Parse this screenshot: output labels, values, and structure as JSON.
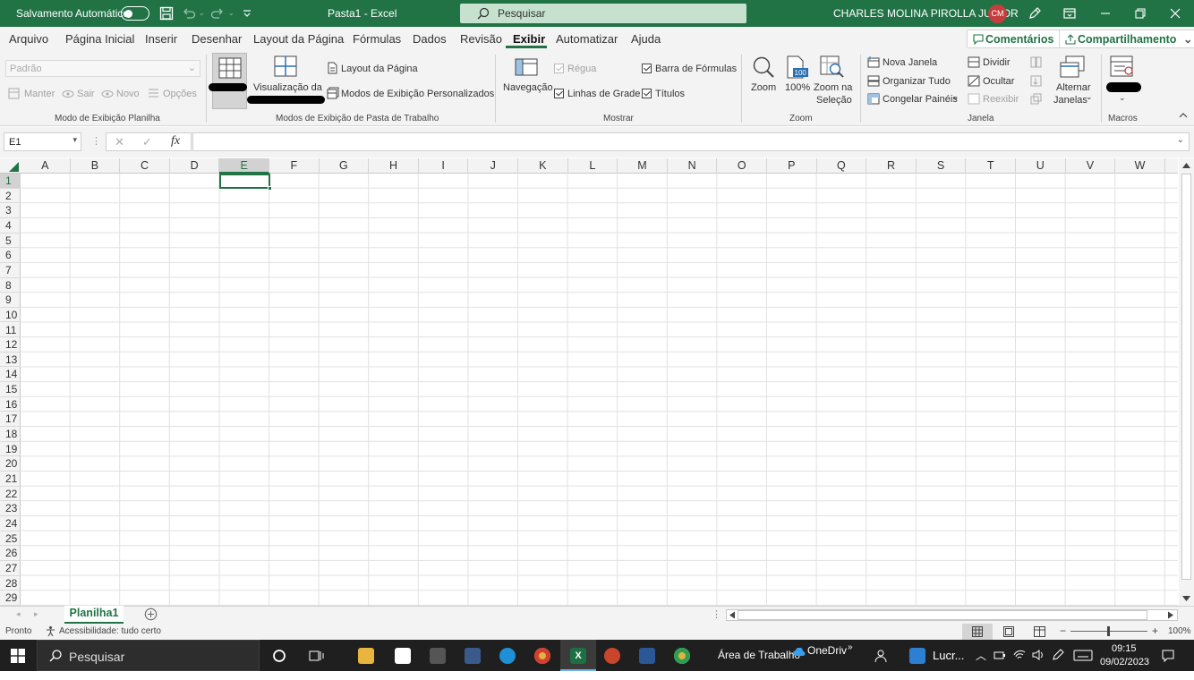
{
  "titlebar": {
    "autosave_label": "Salvamento Automático",
    "doc_title": "Pasta1  -  Excel",
    "search_placeholder": "Pesquisar",
    "user_name": "CHARLES MOLINA PIROLLA JUNIOR",
    "user_initials": "CM"
  },
  "tabs": [
    "Arquivo",
    "Página Inicial",
    "Inserir",
    "Desenhar",
    "Layout da Página",
    "Fórmulas",
    "Dados",
    "Revisão",
    "Exibir",
    "Automatizar",
    "Ajuda"
  ],
  "active_tab": "Exibir",
  "comments_label": "Comentários",
  "share_label": "Compartilhamento",
  "ribbon": {
    "sheet_view": {
      "dropdown_value": "Padrão",
      "keep": "Manter",
      "exit": "Sair",
      "new": "Novo",
      "options": "Opções",
      "group_label": "Modo de Exibição Planilha"
    },
    "workbook_views": {
      "page_break": "Visualização da",
      "page_layout": "Layout da Página",
      "custom_views": "Modos de Exibição Personalizados",
      "group_label": "Modos de Exibição de Pasta de Trabalho"
    },
    "show": {
      "navigation": "Navegação",
      "ruler": "Régua",
      "gridlines": "Linhas de Grade",
      "formula_bar": "Barra de Fórmulas",
      "headings": "Títulos",
      "group_label": "Mostrar"
    },
    "zoom": {
      "zoom": "Zoom",
      "hundred": "100%",
      "zoom_selection_1": "Zoom na",
      "zoom_selection_2": "Seleção",
      "group_label": "Zoom"
    },
    "window": {
      "new_window": "Nova Janela",
      "arrange_all": "Organizar Tudo",
      "freeze_panes": "Congelar Painéis",
      "split": "Dividir",
      "hide": "Ocultar",
      "unhide": "Reexibir",
      "switch_1": "Alternar",
      "switch_2": "Janelas",
      "group_label": "Janela"
    },
    "macros": {
      "group_label": "Macros"
    }
  },
  "formula_bar": {
    "name_box": "E1",
    "fx": "fx",
    "content": ""
  },
  "grid": {
    "columns": [
      "A",
      "B",
      "C",
      "D",
      "E",
      "F",
      "G",
      "H",
      "I",
      "J",
      "K",
      "L",
      "M",
      "N",
      "O",
      "P",
      "Q",
      "R",
      "S",
      "T",
      "U",
      "V",
      "W"
    ],
    "rows": [
      "1",
      "2",
      "3",
      "4",
      "5",
      "6",
      "7",
      "8",
      "9",
      "10",
      "11",
      "12",
      "13",
      "14",
      "15",
      "16",
      "17",
      "18",
      "19",
      "20",
      "21",
      "22",
      "23",
      "24",
      "25",
      "26",
      "27",
      "28",
      "29"
    ],
    "selected_col": "E",
    "selected_row": "1"
  },
  "sheet_tab": "Planilha1",
  "statusbar": {
    "ready": "Pronto",
    "accessibility": "Acessibilidade: tudo certo",
    "zoom": "100%"
  },
  "taskbar": {
    "search": "Pesquisar",
    "desktop": "Área de Trabalho",
    "onedrive": "OneDriv",
    "app_label": "Lucr...",
    "time": "09:15",
    "date": "09/02/2023"
  },
  "colors": {
    "excel_green": "#217346",
    "ribbon_bg": "#f3f3f3",
    "taskbar_bg": "#1f1f1f"
  }
}
